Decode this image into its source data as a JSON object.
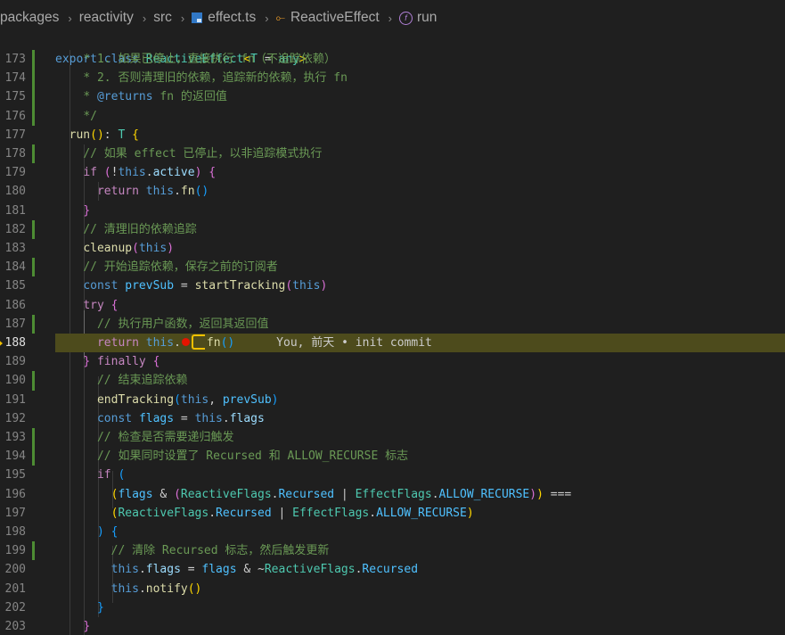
{
  "breadcrumb": {
    "items": [
      "packages",
      "reactivity",
      "src",
      "effect.ts",
      "ReactiveEffect",
      "run"
    ],
    "icons": {
      "file": "typescript-file-icon",
      "class": "class-icon",
      "method": "method-icon"
    }
  },
  "sticky_line": [
    [
      "kw",
      "export"
    ],
    [
      "def",
      " "
    ],
    [
      "kw",
      "class"
    ],
    [
      "def",
      " "
    ],
    [
      "cls",
      "ReactiveEffect"
    ],
    [
      "p1",
      "<"
    ],
    [
      "cls",
      "T"
    ],
    [
      "def",
      " = "
    ],
    [
      "cls",
      "any"
    ],
    [
      "p1",
      ">"
    ]
  ],
  "lines": [
    {
      "n": "173",
      "g": true,
      "t": [
        [
          "def",
          "    "
        ],
        [
          "cmt",
          "* 1. 如果已停止，直接执行 fn（不追踪依赖）"
        ]
      ]
    },
    {
      "n": "174",
      "g": true,
      "t": [
        [
          "def",
          "    "
        ],
        [
          "cmt",
          "* 2. 否则清理旧的依赖，追踪新的依赖，执行 fn"
        ]
      ]
    },
    {
      "n": "175",
      "g": true,
      "t": [
        [
          "def",
          "    "
        ],
        [
          "cmt",
          "* "
        ],
        [
          "cmtkw",
          "@returns"
        ],
        [
          "cmt",
          " fn 的返回值"
        ]
      ]
    },
    {
      "n": "176",
      "g": true,
      "t": [
        [
          "def",
          "    "
        ],
        [
          "cmt",
          "*/"
        ]
      ]
    },
    {
      "n": "177",
      "g": false,
      "t": [
        [
          "def",
          "  "
        ],
        [
          "fn",
          "run"
        ],
        [
          "p1",
          "()"
        ],
        [
          "def",
          ": "
        ],
        [
          "cls",
          "T"
        ],
        [
          "def",
          " "
        ],
        [
          "p1",
          "{"
        ]
      ]
    },
    {
      "n": "178",
      "g": true,
      "t": [
        [
          "def",
          "    "
        ],
        [
          "cmt",
          "// 如果 effect 已停止，以非追踪模式执行"
        ]
      ]
    },
    {
      "n": "179",
      "g": false,
      "t": [
        [
          "def",
          "    "
        ],
        [
          "ctl",
          "if"
        ],
        [
          "def",
          " "
        ],
        [
          "p2",
          "("
        ],
        [
          "op",
          "!"
        ],
        [
          "kw",
          "this"
        ],
        [
          "def",
          "."
        ],
        [
          "var",
          "active"
        ],
        [
          "p2",
          ")"
        ],
        [
          "def",
          " "
        ],
        [
          "p2",
          "{"
        ]
      ]
    },
    {
      "n": "180",
      "g": false,
      "t": [
        [
          "def",
          "      "
        ],
        [
          "ctl",
          "return"
        ],
        [
          "def",
          " "
        ],
        [
          "kw",
          "this"
        ],
        [
          "def",
          "."
        ],
        [
          "fn",
          "fn"
        ],
        [
          "p3",
          "()"
        ]
      ]
    },
    {
      "n": "181",
      "g": false,
      "t": [
        [
          "def",
          "    "
        ],
        [
          "p2",
          "}"
        ]
      ]
    },
    {
      "n": "182",
      "g": true,
      "t": [
        [
          "def",
          "    "
        ],
        [
          "cmt",
          "// 清理旧的依赖追踪"
        ]
      ]
    },
    {
      "n": "183",
      "g": false,
      "t": [
        [
          "def",
          "    "
        ],
        [
          "fn",
          "cleanup"
        ],
        [
          "p2",
          "("
        ],
        [
          "kw",
          "this"
        ],
        [
          "p2",
          ")"
        ]
      ]
    },
    {
      "n": "184",
      "g": true,
      "t": [
        [
          "def",
          "    "
        ],
        [
          "cmt",
          "// 开始追踪依赖，保存之前的订阅者"
        ]
      ]
    },
    {
      "n": "185",
      "g": false,
      "t": [
        [
          "def",
          "    "
        ],
        [
          "kw",
          "const"
        ],
        [
          "def",
          " "
        ],
        [
          "const",
          "prevSub"
        ],
        [
          "def",
          " = "
        ],
        [
          "fn",
          "startTracking"
        ],
        [
          "p2",
          "("
        ],
        [
          "kw",
          "this"
        ],
        [
          "p2",
          ")"
        ]
      ]
    },
    {
      "n": "186",
      "g": false,
      "t": [
        [
          "def",
          "    "
        ],
        [
          "ctl",
          "try"
        ],
        [
          "def",
          " "
        ],
        [
          "p2",
          "{"
        ]
      ]
    },
    {
      "n": "187",
      "g": true,
      "t": [
        [
          "def",
          "      "
        ],
        [
          "cmt",
          "// 执行用户函数，返回其返回值"
        ]
      ]
    },
    {
      "n": "188",
      "g": false,
      "current": true,
      "t": [
        [
          "def",
          "      "
        ],
        [
          "ctl",
          "return"
        ],
        [
          "def",
          " "
        ],
        [
          "kw",
          "this"
        ],
        [
          "def",
          "."
        ],
        [
          "bp",
          ""
        ],
        [
          "ip",
          ""
        ],
        [
          "fn",
          "fn"
        ],
        [
          "p3",
          "()"
        ],
        [
          "blame",
          "      You, 前天 • init commit"
        ]
      ]
    },
    {
      "n": "189",
      "g": false,
      "t": [
        [
          "def",
          "    "
        ],
        [
          "p2",
          "}"
        ],
        [
          "def",
          " "
        ],
        [
          "ctl",
          "finally"
        ],
        [
          "def",
          " "
        ],
        [
          "p2",
          "{"
        ]
      ]
    },
    {
      "n": "190",
      "g": true,
      "t": [
        [
          "def",
          "      "
        ],
        [
          "cmt",
          "// 结束追踪依赖"
        ]
      ]
    },
    {
      "n": "191",
      "g": false,
      "t": [
        [
          "def",
          "      "
        ],
        [
          "fn",
          "endTracking"
        ],
        [
          "p3",
          "("
        ],
        [
          "kw",
          "this"
        ],
        [
          "def",
          ", "
        ],
        [
          "const",
          "prevSub"
        ],
        [
          "p3",
          ")"
        ]
      ]
    },
    {
      "n": "192",
      "g": false,
      "t": [
        [
          "def",
          "      "
        ],
        [
          "kw",
          "const"
        ],
        [
          "def",
          " "
        ],
        [
          "const",
          "flags"
        ],
        [
          "def",
          " = "
        ],
        [
          "kw",
          "this"
        ],
        [
          "def",
          "."
        ],
        [
          "var",
          "flags"
        ]
      ]
    },
    {
      "n": "193",
      "g": true,
      "t": [
        [
          "def",
          "      "
        ],
        [
          "cmt",
          "// 检查是否需要递归触发"
        ]
      ]
    },
    {
      "n": "194",
      "g": true,
      "t": [
        [
          "def",
          "      "
        ],
        [
          "cmt",
          "// 如果同时设置了 Recursed 和 ALLOW_RECURSE 标志"
        ]
      ]
    },
    {
      "n": "195",
      "g": false,
      "t": [
        [
          "def",
          "      "
        ],
        [
          "ctl",
          "if"
        ],
        [
          "def",
          " "
        ],
        [
          "p3",
          "("
        ]
      ]
    },
    {
      "n": "196",
      "g": false,
      "t": [
        [
          "def",
          "        "
        ],
        [
          "p1",
          "("
        ],
        [
          "const",
          "flags"
        ],
        [
          "def",
          " & "
        ],
        [
          "p2",
          "("
        ],
        [
          "cls",
          "ReactiveFlags"
        ],
        [
          "def",
          "."
        ],
        [
          "const",
          "Recursed"
        ],
        [
          "def",
          " | "
        ],
        [
          "cls",
          "EffectFlags"
        ],
        [
          "def",
          "."
        ],
        [
          "const",
          "ALLOW_RECURSE"
        ],
        [
          "p2",
          ")"
        ],
        [
          "p1",
          ")"
        ],
        [
          "def",
          " === "
        ]
      ]
    },
    {
      "n": "197",
      "g": false,
      "t": [
        [
          "def",
          "        "
        ],
        [
          "p1",
          "("
        ],
        [
          "cls",
          "ReactiveFlags"
        ],
        [
          "def",
          "."
        ],
        [
          "const",
          "Recursed"
        ],
        [
          "def",
          " | "
        ],
        [
          "cls",
          "EffectFlags"
        ],
        [
          "def",
          "."
        ],
        [
          "const",
          "ALLOW_RECURSE"
        ],
        [
          "p1",
          ")"
        ]
      ]
    },
    {
      "n": "198",
      "g": false,
      "t": [
        [
          "def",
          "      "
        ],
        [
          "p3",
          ")"
        ],
        [
          "def",
          " "
        ],
        [
          "p3",
          "{"
        ]
      ]
    },
    {
      "n": "199",
      "g": true,
      "t": [
        [
          "def",
          "        "
        ],
        [
          "cmt",
          "// 清除 Recursed 标志，然后触发更新"
        ]
      ]
    },
    {
      "n": "200",
      "g": false,
      "t": [
        [
          "def",
          "        "
        ],
        [
          "kw",
          "this"
        ],
        [
          "def",
          "."
        ],
        [
          "var",
          "flags"
        ],
        [
          "def",
          " = "
        ],
        [
          "const",
          "flags"
        ],
        [
          "def",
          " & ~"
        ],
        [
          "cls",
          "ReactiveFlags"
        ],
        [
          "def",
          "."
        ],
        [
          "const",
          "Recursed"
        ]
      ]
    },
    {
      "n": "201",
      "g": false,
      "t": [
        [
          "def",
          "        "
        ],
        [
          "kw",
          "this"
        ],
        [
          "def",
          "."
        ],
        [
          "fn",
          "notify"
        ],
        [
          "p1",
          "()"
        ]
      ]
    },
    {
      "n": "202",
      "g": false,
      "t": [
        [
          "def",
          "      "
        ],
        [
          "p3",
          "}"
        ]
      ]
    },
    {
      "n": "203",
      "g": false,
      "t": [
        [
          "def",
          "    "
        ],
        [
          "p2",
          "}"
        ]
      ]
    }
  ]
}
